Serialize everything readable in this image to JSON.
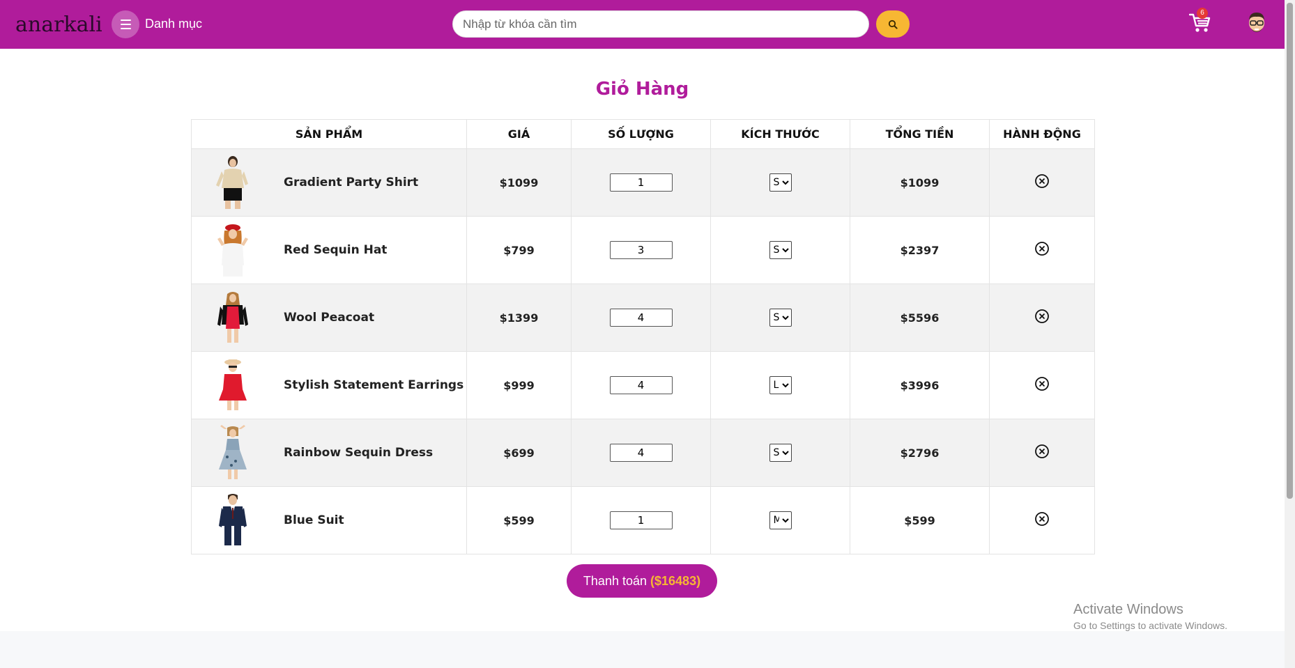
{
  "header": {
    "logo_text": "anarkali",
    "menu_label": "Danh mục",
    "search_placeholder": "Nhập từ khóa cần tìm",
    "cart_count": "6",
    "brand_color": "#b01c9b",
    "accent_color": "#f7b733"
  },
  "page": {
    "title": "Giỏ Hàng"
  },
  "table": {
    "columns": [
      "SẢN PHẨM",
      "GIÁ",
      "SỐ LƯỢNG",
      "KÍCH THƯỚC",
      "TỔNG TIỀN",
      "HÀNH ĐỘNG"
    ],
    "rows": [
      {
        "name": "Gradient Party Shirt",
        "price": "$1099",
        "qty": "1",
        "size": "S",
        "total": "$1099",
        "image": "woman-gold-shirt"
      },
      {
        "name": "Red Sequin Hat",
        "price": "$799",
        "qty": "3",
        "size": "S",
        "total": "$2397",
        "image": "woman-red-beret"
      },
      {
        "name": "Wool Peacoat",
        "price": "$1399",
        "qty": "4",
        "size": "S",
        "total": "$5596",
        "image": "woman-red-dress-black-jacket"
      },
      {
        "name": "Stylish Statement Earrings",
        "price": "$999",
        "qty": "4",
        "size": "L",
        "total": "$3996",
        "image": "girl-red-dress-hat"
      },
      {
        "name": "Rainbow Sequin Dress",
        "price": "$699",
        "qty": "4",
        "size": "S",
        "total": "$2796",
        "image": "woman-floral-dress"
      },
      {
        "name": "Blue Suit",
        "price": "$599",
        "qty": "1",
        "size": "M",
        "total": "$599",
        "image": "man-navy-suit"
      }
    ]
  },
  "checkout": {
    "label": "Thanh toán",
    "total": "($16483)"
  },
  "watermark": {
    "line1": "Activate Windows",
    "line2": "Go to Settings to activate Windows."
  }
}
